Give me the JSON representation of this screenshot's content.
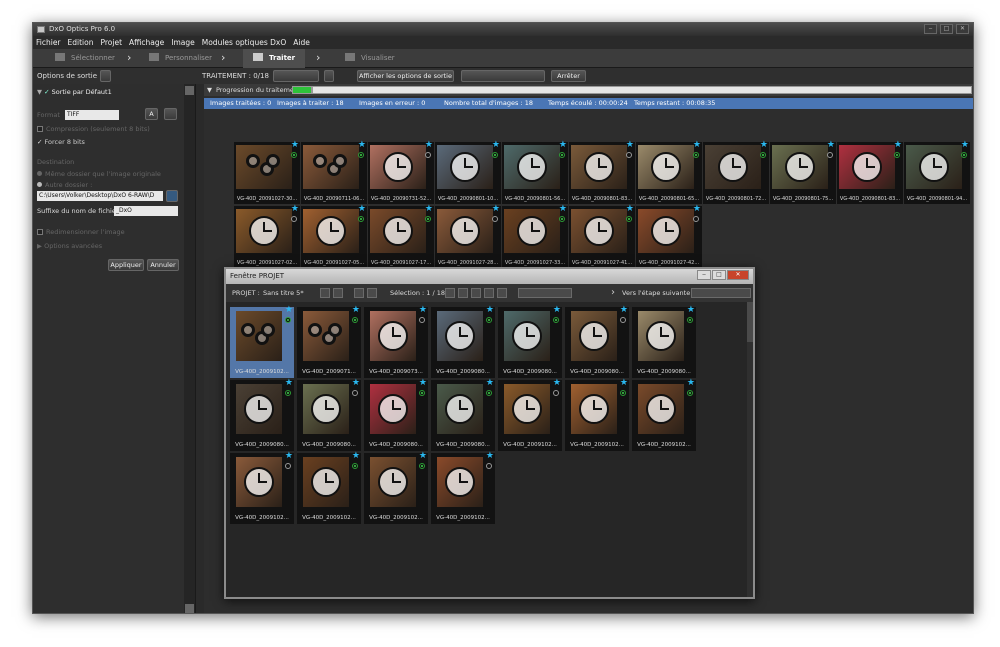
{
  "window": {
    "title": "DxO Optics Pro 6.0",
    "controls": [
      "‒",
      "□",
      "✕"
    ]
  },
  "menu": [
    "Fichier",
    "Edition",
    "Projet",
    "Affichage",
    "Image",
    "Modules optiques DxO",
    "Aide"
  ],
  "steps": [
    "Sélectionner",
    "Personnaliser",
    "Traiter",
    "Visualiser"
  ],
  "toolbar": {
    "output_label": "Options de sortie :",
    "traitement": "TRAITEMENT : 0/18",
    "show_options_btn": "Afficher les options de sortie",
    "stop_btn": "Arrêter"
  },
  "left_panel": {
    "output_name": "Sortie par Défaut1",
    "btn_a": "A",
    "format_label": "Format",
    "format_value": "TIFF",
    "compression": "Compression (seulement 8 bits)",
    "force8": "Forcer 8 bits",
    "destination": "Destination",
    "same_folder": "Même dossier que l'image originale",
    "other_folder": "Autre dossier :",
    "path": "C:\\Users\\Volker\\Desktop\\DxO 6-RAW\\D",
    "suffix_label": "Suffixe du nom de fichier",
    "suffix_value": "_DxO",
    "resize": "Redimensionner l'image",
    "advanced": "Options avancées",
    "apply": "Appliquer",
    "cancel": "Annuler"
  },
  "progress": {
    "label": "Progression du traitement",
    "fraction": 0.03,
    "stats": {
      "traitees": "Images traitées : 0",
      "a_traiter": "Images à traiter : 18",
      "erreur": "Images en erreur : 0",
      "total": "Nombre total d'images : 18",
      "ecoule": "Temps écoulé : 00:00:24",
      "restant": "Temps restant : 00:08:35"
    }
  },
  "processing_thumbs": [
    {
      "caption": "VG-40D_20091027-30...",
      "icon": "gears",
      "bg": "#6b4a2a"
    },
    {
      "caption": "VG-40D_20090711-06...",
      "icon": "gears",
      "bg": "#8a5a3a"
    },
    {
      "caption": "VG-40D_20090731-52...",
      "icon": "clock",
      "bg": "#b07060"
    },
    {
      "caption": "VG-40D_20090801-10...",
      "icon": "clock",
      "bg": "#5a6a7a"
    },
    {
      "caption": "VG-40D_20090801-56...",
      "icon": "clock",
      "bg": "#4e6a6a"
    },
    {
      "caption": "VG-40D_20090801-83...",
      "icon": "clock",
      "bg": "#7a5a3a"
    },
    {
      "caption": "VG-40D_20090801-65...",
      "icon": "clock",
      "bg": "#9a8a6a"
    },
    {
      "caption": "VG-40D_20090801-72...",
      "icon": "clock",
      "bg": "#4a4035"
    },
    {
      "caption": "VG-40D_20090801-75...",
      "icon": "clock",
      "bg": "#6a7050"
    },
    {
      "caption": "VG-40D_20090801-83...",
      "icon": "clock",
      "bg": "#b03040"
    },
    {
      "caption": "VG-40D_20090801-94...",
      "icon": "clock",
      "bg": "#4a5a4a"
    },
    {
      "caption": "VG-40D_20091027-02...",
      "icon": "clock",
      "bg": "#8a5a2a"
    },
    {
      "caption": "VG-40D_20091027-05...",
      "icon": "clock",
      "bg": "#a06030"
    },
    {
      "caption": "VG-40D_20091027-17...",
      "icon": "clock",
      "bg": "#7a4a2a"
    },
    {
      "caption": "VG-40D_20091027-28...",
      "icon": "clock",
      "bg": "#8a5a3a"
    },
    {
      "caption": "VG-40D_20091027-33...",
      "icon": "clock",
      "bg": "#6a4020"
    },
    {
      "caption": "VG-40D_20091027-41...",
      "icon": "clock",
      "bg": "#7a5030"
    },
    {
      "caption": "VG-40D_20091027-42...",
      "icon": "clock",
      "bg": "#8a4a2a"
    }
  ],
  "project_window": {
    "title": "Fenêtre PROJET",
    "projet_label": "PROJET :",
    "projet_name": "Sans titre 5*",
    "selection": "Sélection : 1 / 18",
    "next_step": "Vers l'étape suivante",
    "thumbs": [
      {
        "caption": "VG-40D_2009102...",
        "icon": "gears",
        "bg": "#6b4a2a"
      },
      {
        "caption": "VG-40D_2009071...",
        "icon": "gears",
        "bg": "#8a5a3a"
      },
      {
        "caption": "VG-40D_2009073...",
        "icon": "clock",
        "bg": "#b07060"
      },
      {
        "caption": "VG-40D_2009080...",
        "icon": "clock",
        "bg": "#5a6a7a"
      },
      {
        "caption": "VG-40D_2009080...",
        "icon": "clock",
        "bg": "#4e6a6a"
      },
      {
        "caption": "VG-40D_2009080...",
        "icon": "clock",
        "bg": "#7a5a3a"
      },
      {
        "caption": "VG-40D_2009080...",
        "icon": "clock",
        "bg": "#9a8a6a"
      },
      {
        "caption": "VG-40D_2009080...",
        "icon": "clock",
        "bg": "#4a4035"
      },
      {
        "caption": "VG-40D_2009080...",
        "icon": "clock",
        "bg": "#6a7050"
      },
      {
        "caption": "VG-40D_2009080...",
        "icon": "clock",
        "bg": "#b03040"
      },
      {
        "caption": "VG-40D_2009080...",
        "icon": "clock",
        "bg": "#4a5a4a"
      },
      {
        "caption": "VG-40D_2009102...",
        "icon": "clock",
        "bg": "#8a5a2a"
      },
      {
        "caption": "VG-40D_2009102...",
        "icon": "clock",
        "bg": "#a06030"
      },
      {
        "caption": "VG-40D_2009102...",
        "icon": "clock",
        "bg": "#7a4a2a"
      },
      {
        "caption": "VG-40D_2009102...",
        "icon": "clock",
        "bg": "#8a5a3a"
      },
      {
        "caption": "VG-40D_2009102...",
        "icon": "clock",
        "bg": "#6a4020"
      },
      {
        "caption": "VG-40D_2009102...",
        "icon": "clock",
        "bg": "#7a5030"
      },
      {
        "caption": "VG-40D_2009102...",
        "icon": "clock",
        "bg": "#8a4a2a"
      }
    ]
  },
  "colors": {
    "accent": "#4a76b5",
    "star": "#2ab8f0",
    "progress": "#2ec23a"
  }
}
